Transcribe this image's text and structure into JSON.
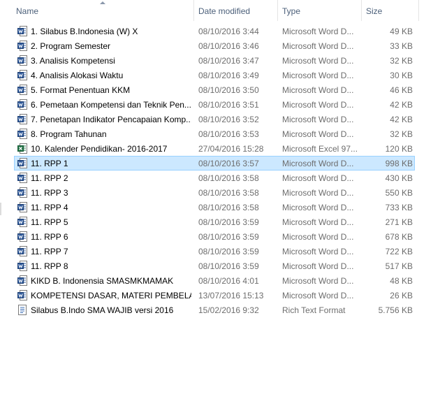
{
  "columns": {
    "name": "Name",
    "date_modified": "Date modified",
    "type": "Type",
    "size": "Size"
  },
  "icons": {
    "word": "word-document-icon",
    "excel": "excel-workbook-icon",
    "rtf": "rtf-document-icon"
  },
  "colors": {
    "selection_bg": "#cce8ff",
    "selection_border": "#99d1ff",
    "header_text": "#4c607a",
    "word_blue": "#2b579a",
    "excel_green": "#217346"
  },
  "files": [
    {
      "name": "1. Silabus B.Indonesia (W) X",
      "date": "08/10/2016 3:44",
      "type": "Microsoft Word D...",
      "size": "49 KB",
      "icon": "word",
      "selected": false
    },
    {
      "name": "2. Program Semester",
      "date": "08/10/2016 3:46",
      "type": "Microsoft Word D...",
      "size": "33 KB",
      "icon": "word",
      "selected": false
    },
    {
      "name": "3. Analisis Kompetensi",
      "date": "08/10/2016 3:47",
      "type": "Microsoft Word D...",
      "size": "32 KB",
      "icon": "word",
      "selected": false
    },
    {
      "name": "4. Analisis Alokasi Waktu",
      "date": "08/10/2016 3:49",
      "type": "Microsoft Word D...",
      "size": "30 KB",
      "icon": "word",
      "selected": false
    },
    {
      "name": "5. Format Penentuan KKM",
      "date": "08/10/2016 3:50",
      "type": "Microsoft Word D...",
      "size": "46 KB",
      "icon": "word",
      "selected": false
    },
    {
      "name": "6. Pemetaan Kompetensi dan Teknik Pen...",
      "date": "08/10/2016 3:51",
      "type": "Microsoft Word D...",
      "size": "42 KB",
      "icon": "word",
      "selected": false
    },
    {
      "name": "7. Penetapan Indikator Pencapaian Komp...",
      "date": "08/10/2016 3:52",
      "type": "Microsoft Word D...",
      "size": "42 KB",
      "icon": "word",
      "selected": false
    },
    {
      "name": "8. Program Tahunan",
      "date": "08/10/2016 3:53",
      "type": "Microsoft Word D...",
      "size": "32 KB",
      "icon": "word",
      "selected": false
    },
    {
      "name": "10. Kalender Pendidikan- 2016-2017",
      "date": "27/04/2016 15:28",
      "type": "Microsoft Excel 97...",
      "size": "120 KB",
      "icon": "excel",
      "selected": false
    },
    {
      "name": "11. RPP 1",
      "date": "08/10/2016 3:57",
      "type": "Microsoft Word D...",
      "size": "998 KB",
      "icon": "word",
      "selected": true
    },
    {
      "name": "11. RPP 2",
      "date": "08/10/2016 3:58",
      "type": "Microsoft Word D...",
      "size": "430 KB",
      "icon": "word",
      "selected": false
    },
    {
      "name": "11. RPP 3",
      "date": "08/10/2016 3:58",
      "type": "Microsoft Word D...",
      "size": "550 KB",
      "icon": "word",
      "selected": false
    },
    {
      "name": "11. RPP 4",
      "date": "08/10/2016 3:58",
      "type": "Microsoft Word D...",
      "size": "733 KB",
      "icon": "word",
      "selected": false
    },
    {
      "name": "11. RPP 5",
      "date": "08/10/2016 3:59",
      "type": "Microsoft Word D...",
      "size": "271 KB",
      "icon": "word",
      "selected": false
    },
    {
      "name": "11. RPP 6",
      "date": "08/10/2016 3:59",
      "type": "Microsoft Word D...",
      "size": "678 KB",
      "icon": "word",
      "selected": false
    },
    {
      "name": "11. RPP 7",
      "date": "08/10/2016 3:59",
      "type": "Microsoft Word D...",
      "size": "722 KB",
      "icon": "word",
      "selected": false
    },
    {
      "name": "11. RPP 8",
      "date": "08/10/2016 3:59",
      "type": "Microsoft Word D...",
      "size": "517 KB",
      "icon": "word",
      "selected": false
    },
    {
      "name": "KIKD B. Indonensia SMASMKMAMAK",
      "date": "08/10/2016 4:01",
      "type": "Microsoft Word D...",
      "size": "48 KB",
      "icon": "word",
      "selected": false
    },
    {
      "name": "KOMPETENSI DASAR, MATERI PEMBELAJ...",
      "date": "13/07/2016 15:13",
      "type": "Microsoft Word D...",
      "size": "26 KB",
      "icon": "word",
      "selected": false
    },
    {
      "name": "Silabus B.Indo SMA WAJIB versi 2016",
      "date": "15/02/2016 9:32",
      "type": "Rich Text Format",
      "size": "5.756 KB",
      "icon": "rtf",
      "selected": false
    }
  ]
}
